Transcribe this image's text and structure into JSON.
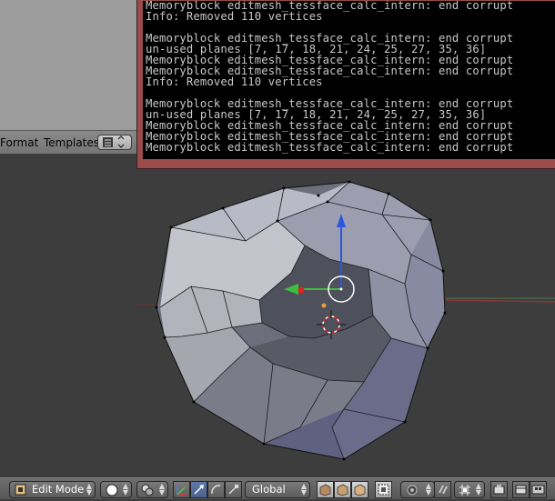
{
  "top_header": {
    "menu_format": "Format",
    "menu_templates": "Templates"
  },
  "console": {
    "lines": [
      "Memoryblock editmesh_tessface_calc_intern: end corrupt",
      "Info: Removed 110 vertices",
      "",
      "Memoryblock editmesh_tessface_calc_intern: end corrupt",
      "un-used planes [7, 17, 18, 21, 24, 25, 27, 35, 36]",
      "Memoryblock editmesh_tessface_calc_intern: end corrupt",
      "Memoryblock editmesh_tessface_calc_intern: end corrupt",
      "Info: Removed 110 vertices",
      "",
      "Memoryblock editmesh_tessface_calc_intern: end corrupt",
      "un-used planes [7, 17, 18, 21, 24, 25, 27, 35, 36]",
      "Memoryblock editmesh_tessface_calc_intern: end corrupt",
      "Memoryblock editmesh_tessface_calc_intern: end corrupt",
      "Memoryblock editmesh_tessface_calc_intern: end corrupt"
    ]
  },
  "bottom_header": {
    "mode_label": "Edit Mode",
    "orientation_label": "Global"
  },
  "colors": {
    "console_bg": "#000000",
    "console_text": "#c8c8c8",
    "x_axis": "#c43b3b",
    "y_axis": "#3fbf3f",
    "z_axis": "#2b57e0",
    "mesh_light": "#b6b8c4",
    "mesh_shadow": "#5c5e6c"
  },
  "icons": {
    "mode_icon": "edit-mode-icon",
    "shading_icon": "solid-shading-icon",
    "pivot_icon": "pivot-icon",
    "manipulator_icon": "manipulator-icon",
    "vertex_select_icon": "vertex-select-icon",
    "edge_select_icon": "edge-select-icon",
    "face_select_icon": "face-select-icon",
    "limit_visible_icon": "limit-visible-icon",
    "proportional_icon": "proportional-edit-icon",
    "snap_icon": "snap-icon",
    "snap_target_icon": "snap-target-icon",
    "render_icon": "render-icon",
    "render_anim_icon": "render-animation-icon"
  }
}
